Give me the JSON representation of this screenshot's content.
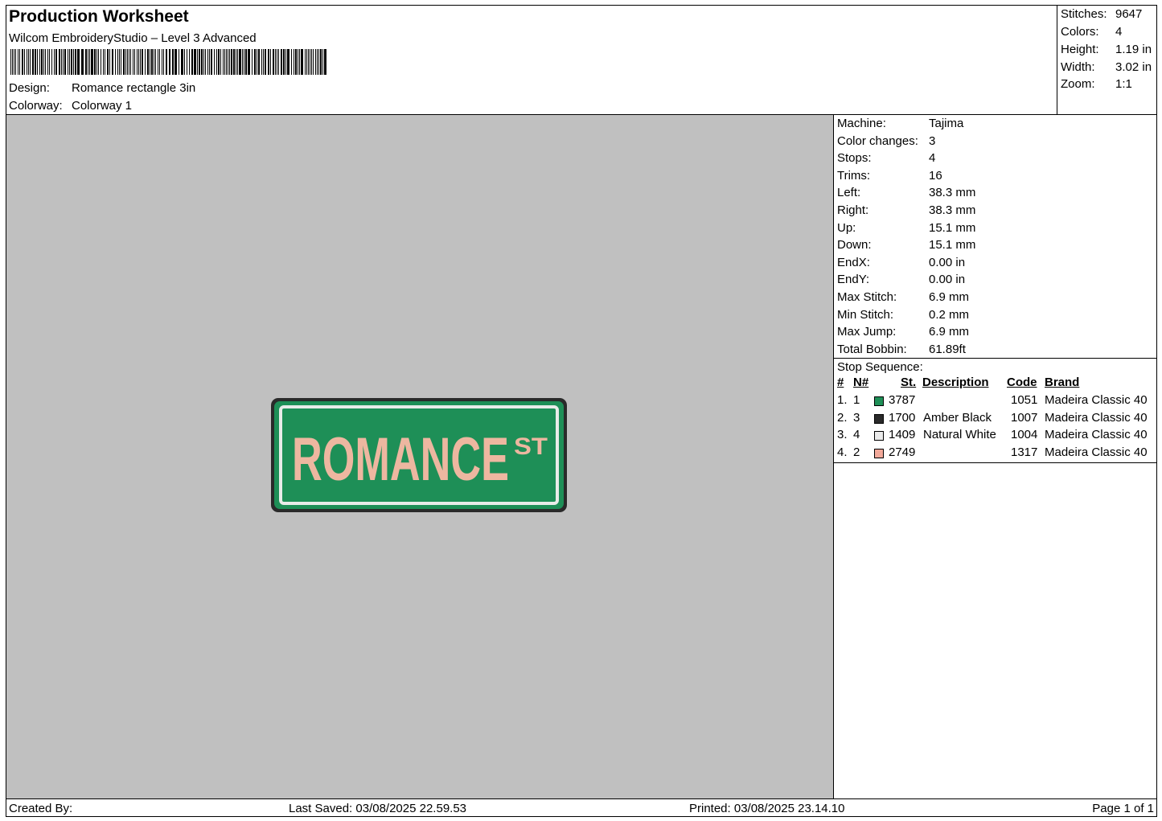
{
  "header": {
    "title": "Production Worksheet",
    "software": "Wilcom EmbroideryStudio – Level 3 Advanced",
    "design_label": "Design:",
    "design_value": "Romance rectangle 3in",
    "colorway_label": "Colorway:",
    "colorway_value": "Colorway 1"
  },
  "stats": [
    {
      "label": "Stitches:",
      "value": "9647"
    },
    {
      "label": "Colors:",
      "value": "4"
    },
    {
      "label": "Height:",
      "value": "1.19 in"
    },
    {
      "label": "Width:",
      "value": "3.02 in"
    },
    {
      "label": "Zoom:",
      "value": "1:1"
    }
  ],
  "design_preview": {
    "main_text": "ROMANCE",
    "suffix_text": "ST",
    "colors": {
      "fill": "#1e8f57",
      "border": "#2a2a2a",
      "inner_border": "#e9ece9",
      "letters": "#edb7a0",
      "canvas": "#c0c0c0"
    }
  },
  "machine": [
    {
      "label": "Machine:",
      "value": "Tajima"
    },
    {
      "label": "Color changes:",
      "value": "3"
    },
    {
      "label": "Stops:",
      "value": "4"
    },
    {
      "label": "Trims:",
      "value": "16"
    },
    {
      "label": "Left:",
      "value": "38.3 mm"
    },
    {
      "label": "Right:",
      "value": "38.3 mm"
    },
    {
      "label": "Up:",
      "value": "15.1 mm"
    },
    {
      "label": "Down:",
      "value": "15.1 mm"
    },
    {
      "label": "EndX:",
      "value": "0.00 in"
    },
    {
      "label": "EndY:",
      "value": "0.00 in"
    },
    {
      "label": "Max Stitch:",
      "value": "6.9 mm"
    },
    {
      "label": "Min Stitch:",
      "value": "0.2 mm"
    },
    {
      "label": "Max Jump:",
      "value": "6.9 mm"
    },
    {
      "label": "Total Bobbin:",
      "value": "61.89ft"
    }
  ],
  "stop_sequence": {
    "title": "Stop Sequence:",
    "headers": {
      "num": "#",
      "n": "N#",
      "st": "St.",
      "description": "Description",
      "code": "Code",
      "brand": "Brand"
    },
    "rows": [
      {
        "num": "1.",
        "n": "1",
        "color": "#1e8f57",
        "st": "3787",
        "description": "",
        "code": "1051",
        "brand": "Madeira Classic 40"
      },
      {
        "num": "2.",
        "n": "3",
        "color": "#2a2a2a",
        "st": "1700",
        "description": "Amber Black",
        "code": "1007",
        "brand": "Madeira Classic 40"
      },
      {
        "num": "3.",
        "n": "4",
        "color": "#ebebeb",
        "st": "1409",
        "description": "Natural White",
        "code": "1004",
        "brand": "Madeira Classic 40"
      },
      {
        "num": "4.",
        "n": "2",
        "color": "#f2a99a",
        "st": "2749",
        "description": "",
        "code": "1317",
        "brand": "Madeira Classic 40"
      }
    ]
  },
  "footer": {
    "created_by": "Created By:",
    "last_saved": "Last Saved: 03/08/2025 22.59.53",
    "printed": "Printed: 03/08/2025 23.14.10",
    "page": "Page 1 of 1"
  }
}
